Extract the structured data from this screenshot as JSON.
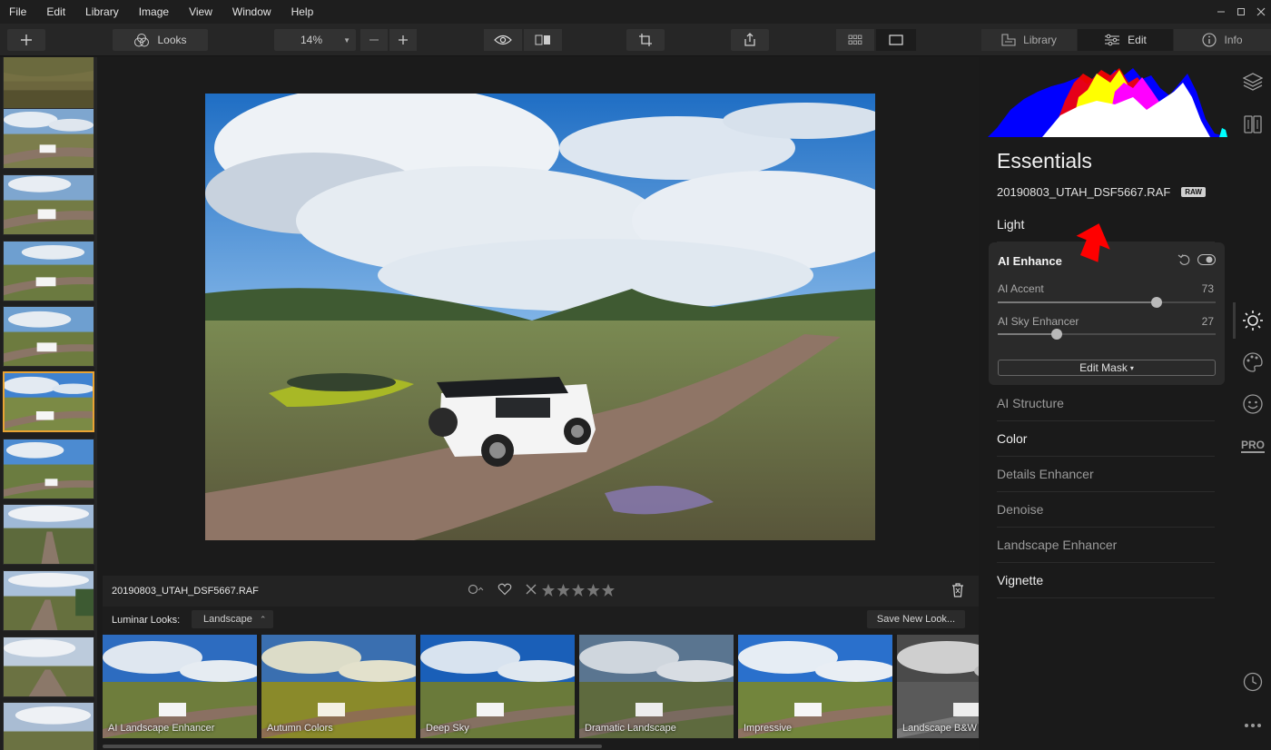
{
  "menu": [
    "File",
    "Edit",
    "Library",
    "Image",
    "View",
    "Window",
    "Help"
  ],
  "window_controls": [
    "minimize-icon",
    "maximize-icon",
    "close-icon"
  ],
  "toolbar": {
    "looks_label": "Looks",
    "zoom_value": "14%",
    "tabs": [
      {
        "label": "Library",
        "icon": "library-icon",
        "active": false
      },
      {
        "label": "Edit",
        "icon": "sliders-icon",
        "active": true
      },
      {
        "label": "Info",
        "icon": "info-icon",
        "active": false
      }
    ]
  },
  "image": {
    "filename": "20190803_UTAH_DSF5667.RAF",
    "filename_strip": "20190803_UTAH_DSF5667.RAF",
    "stars": 5
  },
  "looks": {
    "label": "Luminar Looks:",
    "category": "Landscape",
    "save_label": "Save New Look...",
    "items": [
      {
        "name": "AI Landscape Enhancer"
      },
      {
        "name": "Autumn Colors"
      },
      {
        "name": "Deep Sky"
      },
      {
        "name": "Dramatic Landscape"
      },
      {
        "name": "Impressive"
      },
      {
        "name": "Landscape B&W"
      }
    ]
  },
  "panel": {
    "title": "Essentials",
    "filename": "20190803_UTAH_DSF5667.RAF",
    "raw_badge": "RAW",
    "light": "Light",
    "ai_enhance": {
      "title": "AI Enhance",
      "sliders": [
        {
          "label": "AI Accent",
          "value": 73
        },
        {
          "label": "AI Sky Enhancer",
          "value": 27
        }
      ],
      "edit_mask": "Edit Mask"
    },
    "sections": [
      {
        "label": "AI Structure",
        "style": "dim"
      },
      {
        "label": "Color",
        "style": "bright"
      },
      {
        "label": "Details Enhancer",
        "style": "dim"
      },
      {
        "label": "Denoise",
        "style": "dim"
      },
      {
        "label": "Landscape Enhancer",
        "style": "dim"
      },
      {
        "label": "Vignette",
        "style": "bright"
      }
    ]
  },
  "rail_icons": [
    "layers-icon",
    "canvas-icon",
    "sun-icon",
    "palette-icon",
    "face-icon",
    "pro-icon",
    "history-icon",
    "more-icon"
  ],
  "rail_pro_label": "PRO",
  "colors": {
    "accent": "#e8a334",
    "annotation_arrow": "#ff0000"
  }
}
